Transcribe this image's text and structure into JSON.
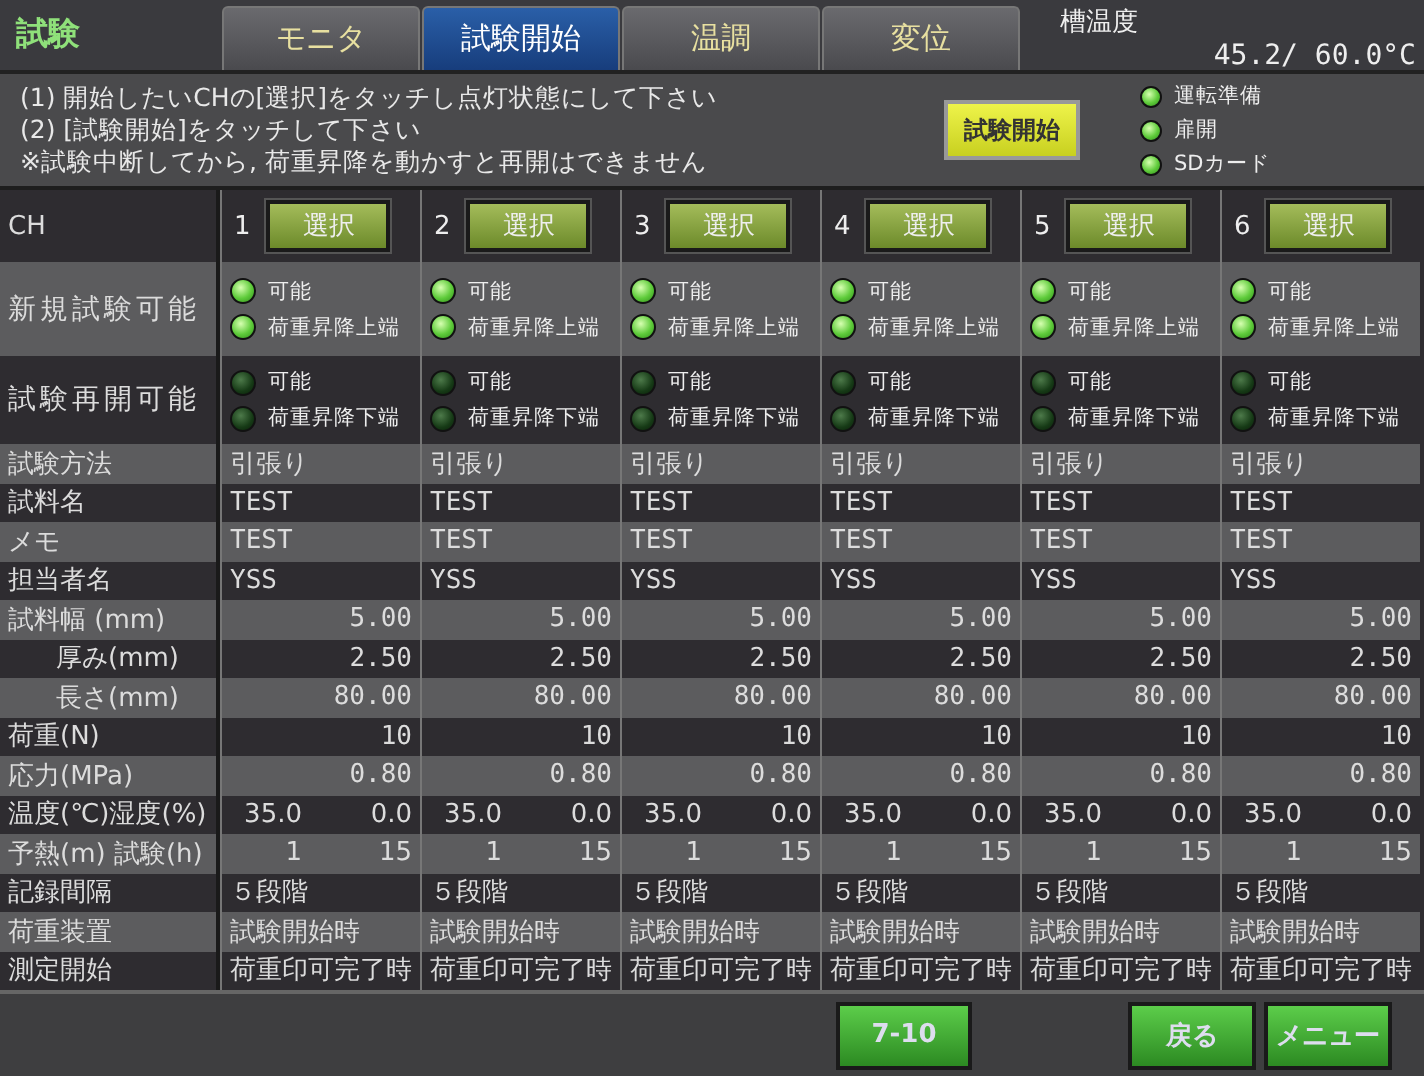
{
  "header": {
    "title": "試験",
    "tabs": [
      {
        "label": "モニタ",
        "selected": false
      },
      {
        "label": "試験開始",
        "selected": true
      },
      {
        "label": "温調",
        "selected": false
      },
      {
        "label": "変位",
        "selected": false
      }
    ],
    "temp_label": "槽温度",
    "temp_value": "45.2/ 60.0°C"
  },
  "instructions": [
    "(1) 開始したいCHの[選択]をタッチし点灯状態にして下さい",
    "(2) [試験開始]をタッチして下さい",
    "※試験中断してから, 荷重昇降を動かすと再開はできません"
  ],
  "start_button": "試験開始",
  "indicators": [
    {
      "label": "運転準備",
      "on": true
    },
    {
      "label": "扉開",
      "on": true
    },
    {
      "label": "SDカード",
      "on": true
    }
  ],
  "ch_label": "CH",
  "channels": [
    {
      "number": "1",
      "button": "選択"
    },
    {
      "number": "2",
      "button": "選択"
    },
    {
      "number": "3",
      "button": "選択"
    },
    {
      "number": "4",
      "button": "選択"
    },
    {
      "number": "5",
      "button": "選択"
    },
    {
      "number": "6",
      "button": "選択"
    }
  ],
  "lamp_rows": [
    {
      "label": "新規試験可能",
      "lamps": [
        [
          {
            "label": "可能",
            "on": true
          },
          {
            "label": "荷重昇降上端",
            "on": true
          }
        ],
        [
          {
            "label": "可能",
            "on": true
          },
          {
            "label": "荷重昇降上端",
            "on": true
          }
        ],
        [
          {
            "label": "可能",
            "on": true
          },
          {
            "label": "荷重昇降上端",
            "on": true
          }
        ],
        [
          {
            "label": "可能",
            "on": true
          },
          {
            "label": "荷重昇降上端",
            "on": true
          }
        ],
        [
          {
            "label": "可能",
            "on": true
          },
          {
            "label": "荷重昇降上端",
            "on": true
          }
        ],
        [
          {
            "label": "可能",
            "on": true
          },
          {
            "label": "荷重昇降上端",
            "on": true
          }
        ]
      ]
    },
    {
      "label": "試験再開可能",
      "lamps": [
        [
          {
            "label": "可能",
            "on": false
          },
          {
            "label": "荷重昇降下端",
            "on": false
          }
        ],
        [
          {
            "label": "可能",
            "on": false
          },
          {
            "label": "荷重昇降下端",
            "on": false
          }
        ],
        [
          {
            "label": "可能",
            "on": false
          },
          {
            "label": "荷重昇降下端",
            "on": false
          }
        ],
        [
          {
            "label": "可能",
            "on": false
          },
          {
            "label": "荷重昇降下端",
            "on": false
          }
        ],
        [
          {
            "label": "可能",
            "on": false
          },
          {
            "label": "荷重昇降下端",
            "on": false
          }
        ],
        [
          {
            "label": "可能",
            "on": false
          },
          {
            "label": "荷重昇降下端",
            "on": false
          }
        ]
      ]
    }
  ],
  "rows": [
    {
      "label": "試験方法",
      "kind": "text",
      "indented": false,
      "cells": [
        "引張り",
        "引張り",
        "引張り",
        "引張り",
        "引張り",
        "引張り"
      ]
    },
    {
      "label": "試料名",
      "kind": "text",
      "indented": false,
      "cells": [
        "TEST",
        "TEST",
        "TEST",
        "TEST",
        "TEST",
        "TEST"
      ]
    },
    {
      "label": "メモ",
      "kind": "text",
      "indented": false,
      "cells": [
        "TEST",
        "TEST",
        "TEST",
        "TEST",
        "TEST",
        "TEST"
      ]
    },
    {
      "label": "担当者名",
      "kind": "text",
      "indented": false,
      "cells": [
        "YSS",
        "YSS",
        "YSS",
        "YSS",
        "YSS",
        "YSS"
      ]
    },
    {
      "label": "試料幅 (mm)",
      "kind": "number",
      "indented": false,
      "cells": [
        "5.00",
        "5.00",
        "5.00",
        "5.00",
        "5.00",
        "5.00"
      ]
    },
    {
      "label": "厚み(mm)",
      "kind": "number",
      "indented": true,
      "cells": [
        "2.50",
        "2.50",
        "2.50",
        "2.50",
        "2.50",
        "2.50"
      ]
    },
    {
      "label": "長さ(mm)",
      "kind": "number",
      "indented": true,
      "cells": [
        "80.00",
        "80.00",
        "80.00",
        "80.00",
        "80.00",
        "80.00"
      ]
    },
    {
      "label": "荷重(N)",
      "kind": "number",
      "indented": false,
      "cells": [
        "10",
        "10",
        "10",
        "10",
        "10",
        "10"
      ]
    },
    {
      "label": "応力(MPa)",
      "kind": "number",
      "indented": false,
      "cells": [
        "0.80",
        "0.80",
        "0.80",
        "0.80",
        "0.80",
        "0.80"
      ]
    },
    {
      "label": "温度(℃)湿度(%)",
      "kind": "pair",
      "indented": false,
      "cells": [
        [
          "35.0",
          "0.0"
        ],
        [
          "35.0",
          "0.0"
        ],
        [
          "35.0",
          "0.0"
        ],
        [
          "35.0",
          "0.0"
        ],
        [
          "35.0",
          "0.0"
        ],
        [
          "35.0",
          "0.0"
        ]
      ]
    },
    {
      "label": "予熱(m) 試験(h)",
      "kind": "pair",
      "indented": false,
      "cells": [
        [
          "1",
          "15"
        ],
        [
          "1",
          "15"
        ],
        [
          "1",
          "15"
        ],
        [
          "1",
          "15"
        ],
        [
          "1",
          "15"
        ],
        [
          "1",
          "15"
        ]
      ]
    },
    {
      "label": "記録間隔",
      "kind": "text",
      "indented": false,
      "cells": [
        "５段階",
        "５段階",
        "５段階",
        "５段階",
        "５段階",
        "５段階"
      ]
    },
    {
      "label": "荷重装置",
      "kind": "text",
      "indented": false,
      "cells": [
        "試験開始時",
        "試験開始時",
        "試験開始時",
        "試験開始時",
        "試験開始時",
        "試験開始時"
      ]
    },
    {
      "label": "測定開始",
      "kind": "text",
      "indented": false,
      "cells": [
        "荷重印可完了時",
        "荷重印可完了時",
        "荷重印可完了時",
        "荷重印可完了時",
        "荷重印可完了時",
        "荷重印可完了時"
      ]
    }
  ],
  "footer_buttons": [
    {
      "label": "7-10",
      "kind": "page"
    },
    {
      "label": "戻る",
      "kind": "nav"
    },
    {
      "label": "メニュー",
      "kind": "nav"
    }
  ]
}
